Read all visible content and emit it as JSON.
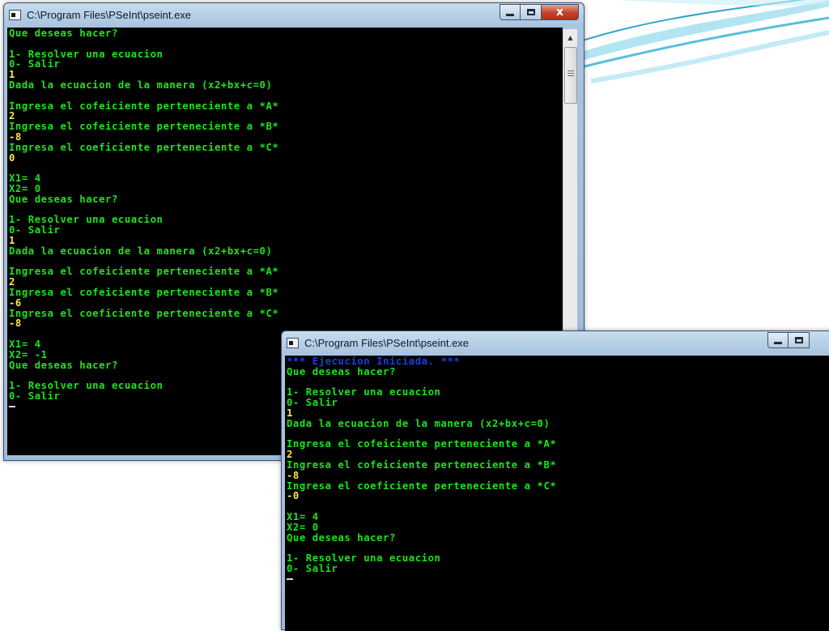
{
  "windows": [
    {
      "title": "C:\\Program Files\\PSeInt\\pseint.exe",
      "lines": [
        {
          "t": "Que deseas hacer?",
          "c": "g"
        },
        {
          "t": "",
          "c": "g"
        },
        {
          "t": "1- Resolver una ecuacion",
          "c": "g"
        },
        {
          "t": "0- Salir",
          "c": "g"
        },
        {
          "t": "1",
          "c": "y"
        },
        {
          "t": "Dada la ecuacion de la manera (x2+bx+c=0)",
          "c": "g"
        },
        {
          "t": "",
          "c": "g"
        },
        {
          "t": "Ingresa el cofeiciente perteneciente a *A*",
          "c": "g"
        },
        {
          "t": "2",
          "c": "y"
        },
        {
          "t": "Ingresa el cofeiciente perteneciente a *B*",
          "c": "g"
        },
        {
          "t": "-8",
          "c": "y"
        },
        {
          "t": "Ingresa el coeficiente perteneciente a *C*",
          "c": "g"
        },
        {
          "t": "0",
          "c": "y"
        },
        {
          "t": "",
          "c": "g"
        },
        {
          "t": "X1= 4",
          "c": "g"
        },
        {
          "t": "X2= 0",
          "c": "g"
        },
        {
          "t": "Que deseas hacer?",
          "c": "g"
        },
        {
          "t": "",
          "c": "g"
        },
        {
          "t": "1- Resolver una ecuacion",
          "c": "g"
        },
        {
          "t": "0- Salir",
          "c": "g"
        },
        {
          "t": "1",
          "c": "y"
        },
        {
          "t": "Dada la ecuacion de la manera (x2+bx+c=0)",
          "c": "g"
        },
        {
          "t": "",
          "c": "g"
        },
        {
          "t": "Ingresa el cofeiciente perteneciente a *A*",
          "c": "g"
        },
        {
          "t": "2",
          "c": "y"
        },
        {
          "t": "Ingresa el cofeiciente perteneciente a *B*",
          "c": "g"
        },
        {
          "t": "-6",
          "c": "y"
        },
        {
          "t": "Ingresa el coeficiente perteneciente a *C*",
          "c": "g"
        },
        {
          "t": "-8",
          "c": "y"
        },
        {
          "t": "",
          "c": "g"
        },
        {
          "t": "X1= 4",
          "c": "g"
        },
        {
          "t": "X2= -1",
          "c": "g"
        },
        {
          "t": "Que deseas hacer?",
          "c": "g"
        },
        {
          "t": "",
          "c": "g"
        },
        {
          "t": "1- Resolver una ecuacion",
          "c": "g"
        },
        {
          "t": "0- Salir",
          "c": "g"
        }
      ],
      "has_scrollbar": true
    },
    {
      "title": "C:\\Program Files\\PSeInt\\pseint.exe",
      "lines": [
        {
          "t": "*** Ejecucion Iniciada. ***",
          "c": "b"
        },
        {
          "t": "Que deseas hacer?",
          "c": "g"
        },
        {
          "t": "",
          "c": "g"
        },
        {
          "t": "1- Resolver una ecuacion",
          "c": "g"
        },
        {
          "t": "0- Salir",
          "c": "g"
        },
        {
          "t": "1",
          "c": "y"
        },
        {
          "t": "Dada la ecuacion de la manera (x2+bx+c=0)",
          "c": "g"
        },
        {
          "t": "",
          "c": "g"
        },
        {
          "t": "Ingresa el cofeiciente perteneciente a *A*",
          "c": "g"
        },
        {
          "t": "2",
          "c": "y"
        },
        {
          "t": "Ingresa el cofeiciente perteneciente a *B*",
          "c": "g"
        },
        {
          "t": "-8",
          "c": "y"
        },
        {
          "t": "Ingresa el coeficiente perteneciente a *C*",
          "c": "g"
        },
        {
          "t": "-0",
          "c": "y"
        },
        {
          "t": "",
          "c": "g"
        },
        {
          "t": "X1= 4",
          "c": "g"
        },
        {
          "t": "X2= 0",
          "c": "g"
        },
        {
          "t": "Que deseas hacer?",
          "c": "g"
        },
        {
          "t": "",
          "c": "g"
        },
        {
          "t": "1- Resolver una ecuacion",
          "c": "g"
        },
        {
          "t": "0- Salir",
          "c": "g"
        }
      ],
      "has_scrollbar": false
    }
  ],
  "controls": {
    "minimize_icon": "minimize-icon",
    "maximize_icon": "maximize-icon",
    "close_icon": "close-icon",
    "close_glyph": "x"
  },
  "colors": {
    "prompt_text": "#19e619",
    "input_text": "#f5e94a",
    "banner_text": "#1e3ce6",
    "console_bg": "#000000"
  }
}
